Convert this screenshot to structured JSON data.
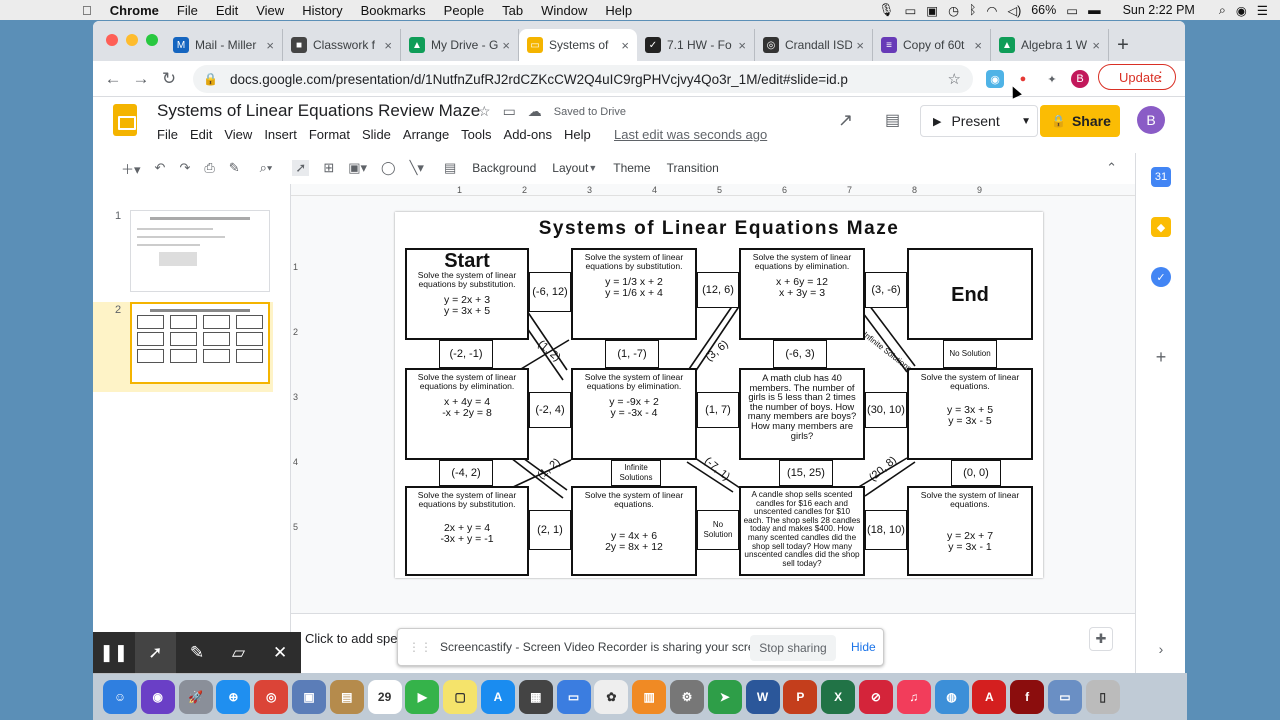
{
  "menubar": {
    "app": "Chrome",
    "items": [
      "File",
      "Edit",
      "View",
      "History",
      "Bookmarks",
      "People",
      "Tab",
      "Window",
      "Help"
    ],
    "battery": "66%",
    "clock": "Sun 2:22 PM"
  },
  "tabs": [
    {
      "label": "Mail - Miller",
      "color": "#1565c0",
      "glyph": "M"
    },
    {
      "label": "Classwork f",
      "color": "#444",
      "glyph": "■"
    },
    {
      "label": "My Drive - G",
      "color": "#0f9d58",
      "glyph": "▲"
    },
    {
      "label": "Systems of",
      "color": "#f4b400",
      "glyph": "▭"
    },
    {
      "label": "7.1 HW - Fo",
      "color": "#222",
      "glyph": "✓"
    },
    {
      "label": "Crandall ISD",
      "color": "#333",
      "glyph": "◎"
    },
    {
      "label": "Copy of 60t",
      "color": "#673ab7",
      "glyph": "≡"
    },
    {
      "label": "Algebra 1 W",
      "color": "#0f9d58",
      "glyph": "▲"
    }
  ],
  "url": "docs.google.com/presentation/d/1NutfnZufRJ2rdCZKcCW2Q4uIC9rgPHVcjvy4Qo3r_1M/edit#slide=id.p",
  "update_label": "Update",
  "doc": {
    "title": "Systems of Linear Equations Review Maze",
    "saved": "Saved to Drive",
    "last_edit": "Last edit was seconds ago",
    "present": "Present",
    "share": "Share",
    "avatar": "B",
    "menus": [
      "File",
      "Edit",
      "View",
      "Insert",
      "Format",
      "Slide",
      "Arrange",
      "Tools",
      "Add-ons",
      "Help"
    ]
  },
  "toolbar": {
    "background": "Background",
    "layout": "Layout",
    "theme": "Theme",
    "transition": "Transition"
  },
  "ruler": [
    "1",
    "2",
    "3",
    "4",
    "5",
    "6",
    "7",
    "8",
    "9"
  ],
  "vruler": [
    "1",
    "2",
    "3",
    "4",
    "5"
  ],
  "filmstrip": [
    {
      "num": "1"
    },
    {
      "num": "2"
    }
  ],
  "slide": {
    "title": "Systems of Linear Equations Maze",
    "start": "Start",
    "end": "End",
    "boxes": [
      {
        "text": "Solve the system of linear equations by substitution.",
        "eq": "y = 2x + 3\ny = 3x + 5"
      },
      {
        "text": "Solve the system of linear equations by substitution.",
        "eq": "y = 1/3 x + 2\ny = 1/6 x + 4"
      },
      {
        "text": "Solve the system of linear equations by elimination.",
        "eq": "x + 6y = 12\nx + 3y = 3"
      },
      {
        "text": "Solve the system of linear equations by elimination.",
        "eq": "x + 4y = 4\n-x + 2y = 8"
      },
      {
        "text": "Solve the system of linear equations by elimination.",
        "eq": "y = -9x + 2\ny = -3x - 4"
      },
      {
        "text": "A math club has 40 members. The number of girls is 5 less than 2 times the number of boys. How many members are boys? How many members are girls?",
        "eq": ""
      },
      {
        "text": "Solve the system of linear equations.",
        "eq": "y = 3x + 5\ny = 3x - 5"
      },
      {
        "text": "Solve the system of linear equations by substitution.",
        "eq": "2x + y = 4\n-3x + y = -1"
      },
      {
        "text": "Solve the system of linear equations.",
        "eq": "y = 4x + 6\n2y = 8x + 12"
      },
      {
        "text": "A candle shop sells scented candles for $16 each and unscented candles for $10 each. The shop sells 28 candles today and makes $400. How many scented candles did the shop sell today? How many unscented candles did the shop sell today?",
        "eq": ""
      },
      {
        "text": "Solve the system of linear equations.",
        "eq": "y = 2x + 7\ny = 3x - 1"
      }
    ],
    "answers": [
      "(-6, 12)",
      "(12, 6)",
      "(3, -6)",
      "(-2, -1)",
      "(1, 2)",
      "(1, -7)",
      "(3, 6)",
      "(-6, 3)",
      "Infinite Solutions",
      "No Solution",
      "(-2, 4)",
      "(1, 7)",
      "(30, 10)",
      "(-4, 2)",
      "(1, 2)",
      "Infinite Solutions",
      "(-7, 1)",
      "(15, 25)",
      "(20, 8)",
      "(0, 0)",
      "(2, 1)",
      "No Solution",
      "(18, 10)"
    ]
  },
  "notes": "Click to add speaker notes",
  "sharebar": {
    "text": "Screencastify - Screen Video Recorder is sharing your screen.",
    "stop": "Stop sharing",
    "hide": "Hide"
  },
  "dock": [
    {
      "name": "finder",
      "color": "#2f7fe0",
      "glyph": "☺"
    },
    {
      "name": "siri",
      "color": "#6a3fc6",
      "glyph": "◉"
    },
    {
      "name": "launchpad",
      "color": "#8a8f99",
      "glyph": "🚀"
    },
    {
      "name": "safari",
      "color": "#1f8ff0",
      "glyph": "⊕"
    },
    {
      "name": "chrome",
      "color": "#db4437",
      "glyph": "◎"
    },
    {
      "name": "preview",
      "color": "#5b7db8",
      "glyph": "▣"
    },
    {
      "name": "notes-app",
      "color": "#b58b4c",
      "glyph": "▤"
    },
    {
      "name": "calendar",
      "color": "#ffffff",
      "glyph": "29"
    },
    {
      "name": "facetime",
      "color": "#35b34a",
      "glyph": "▶"
    },
    {
      "name": "stickies",
      "color": "#f5e36b",
      "glyph": "▢"
    },
    {
      "name": "app-store",
      "color": "#1a8cf0",
      "glyph": "A"
    },
    {
      "name": "photo-booth",
      "color": "#444",
      "glyph": "▦"
    },
    {
      "name": "keynote",
      "color": "#3b7de0",
      "glyph": "▭"
    },
    {
      "name": "photos",
      "color": "#eee",
      "glyph": "✿"
    },
    {
      "name": "books",
      "color": "#f08a24",
      "glyph": "▥"
    },
    {
      "name": "system-prefs",
      "color": "#777",
      "glyph": "⚙"
    },
    {
      "name": "maps",
      "color": "#2e9e48",
      "glyph": "➤"
    },
    {
      "name": "word",
      "color": "#2b579a",
      "glyph": "W"
    },
    {
      "name": "powerpoint",
      "color": "#c43e1c",
      "glyph": "P"
    },
    {
      "name": "excel",
      "color": "#217346",
      "glyph": "X"
    },
    {
      "name": "no-entry",
      "color": "#d4243a",
      "glyph": "⊘"
    },
    {
      "name": "music",
      "color": "#f23d5b",
      "glyph": "♫"
    },
    {
      "name": "globe",
      "color": "#3c8fd8",
      "glyph": "◍"
    },
    {
      "name": "acrobat",
      "color": "#d41f1f",
      "glyph": "A"
    },
    {
      "name": "flash",
      "color": "#8b0d0d",
      "glyph": "f"
    },
    {
      "name": "id-card",
      "color": "#6a8fc4",
      "glyph": "▭"
    },
    {
      "name": "trash",
      "color": "#bbb",
      "glyph": "▯"
    }
  ]
}
